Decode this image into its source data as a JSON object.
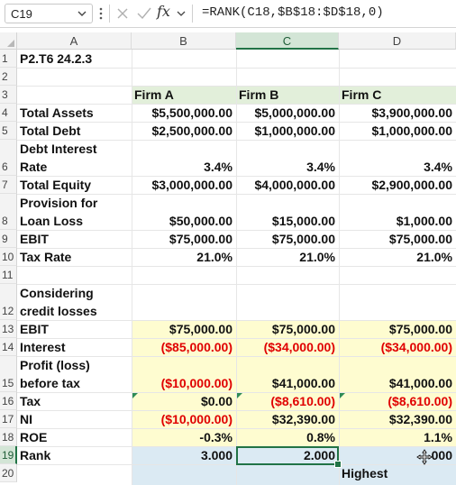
{
  "formula_bar": {
    "name_box": "C19",
    "fx_label": "fx",
    "formula": "=RANK(C18,$B$18:$D$18,0)"
  },
  "columns": [
    "A",
    "B",
    "C",
    "D"
  ],
  "rows": [
    "1",
    "2",
    "3",
    "4",
    "5",
    "6",
    "7",
    "8",
    "9",
    "10",
    "11",
    "12",
    "13",
    "14",
    "15",
    "16",
    "17",
    "18",
    "19",
    "20"
  ],
  "sheet": {
    "title": "P2.T6 24.2.3",
    "headers": {
      "b": "Firm A",
      "c": "Firm B",
      "d": "Firm C"
    },
    "labels": {
      "r4": "Total Assets",
      "r5": "Total Debt",
      "r6a": "Debt Interest",
      "r6b": "Rate",
      "r7": "Total Equity",
      "r8a": "Provision for",
      "r8b": "Loan Loss",
      "r9": "EBIT",
      "r10": "Tax Rate",
      "r12a": "Considering",
      "r12b": "credit losses",
      "r13": "EBIT",
      "r14": "Interest",
      "r15a": "Profit (loss)",
      "r15b": "before tax",
      "r16": "Tax",
      "r17": "NI",
      "r18": "ROE",
      "r19": "Rank"
    },
    "values": {
      "r4": [
        "$5,500,000.00",
        "$5,000,000.00",
        "$3,900,000.00"
      ],
      "r5": [
        "$2,500,000.00",
        "$1,000,000.00",
        "$1,000,000.00"
      ],
      "r6": [
        "3.4%",
        "3.4%",
        "3.4%"
      ],
      "r7": [
        "$3,000,000.00",
        "$4,000,000.00",
        "$2,900,000.00"
      ],
      "r8": [
        "$50,000.00",
        "$15,000.00",
        "$1,000.00"
      ],
      "r9": [
        "$75,000.00",
        "$75,000.00",
        "$75,000.00"
      ],
      "r10": [
        "21.0%",
        "21.0%",
        "21.0%"
      ],
      "r13": [
        "$75,000.00",
        "$75,000.00",
        "$75,000.00"
      ],
      "r14": [
        "($85,000.00)",
        "($34,000.00)",
        "($34,000.00)"
      ],
      "r15": [
        "($10,000.00)",
        "$41,000.00",
        "$41,000.00"
      ],
      "r16": [
        "$0.00",
        "($8,610.00)",
        "($8,610.00)"
      ],
      "r17": [
        "($10,000.00)",
        "$32,390.00",
        "$32,390.00"
      ],
      "r18": [
        "-0.3%",
        "0.8%",
        "1.1%"
      ],
      "r19": [
        "3.000",
        "2.000",
        "000"
      ]
    },
    "note_r20": "Highest"
  },
  "colors": {
    "accent": "#217346",
    "header_fill": "#e2efda",
    "yellow_fill": "#fefcd0",
    "blue_fill": "#dbeaf3",
    "negative": "#e00000"
  },
  "icons": {
    "namebox_dropdown": "chevron-down-icon",
    "more": "vertical-dots-icon",
    "cancel": "close-icon",
    "enter": "check-icon",
    "fx_dropdown": "chevron-down-icon",
    "cursor": "move-cursor-icon"
  }
}
